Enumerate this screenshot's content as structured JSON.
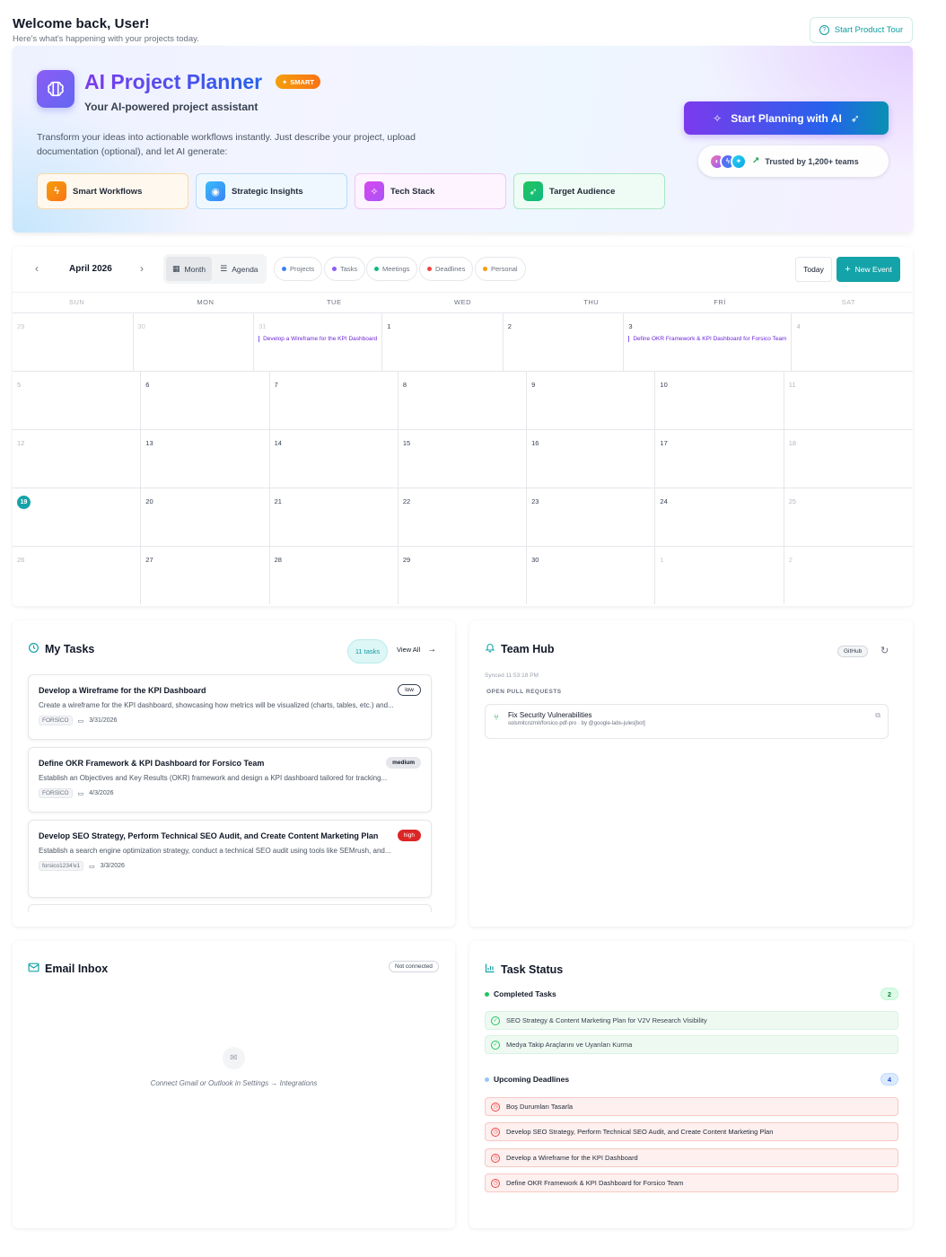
{
  "header": {
    "title": "Welcome back, User!",
    "subtitle": "Here's what's happening with your projects today.",
    "tour_button": "Start Product Tour"
  },
  "hero": {
    "title": "AI Project Planner",
    "badge": "SMART",
    "subtitle": "Your AI-powered project assistant",
    "description": "Transform your ideas into actionable workflows instantly. Just describe your project, upload documentation (optional), and let AI generate:",
    "features": [
      "Smart Workflows",
      "Strategic Insights",
      "Tech Stack",
      "Target Audience"
    ],
    "cta": "Start Planning with AI",
    "trusted": "Trusted by 1,200+ teams"
  },
  "calendar": {
    "month": "April 2026",
    "views": [
      "Month",
      "Agenda"
    ],
    "filters": [
      {
        "label": "Projects",
        "color": "#3b82f6"
      },
      {
        "label": "Tasks",
        "color": "#8b5cf6"
      },
      {
        "label": "Meetings",
        "color": "#10b981"
      },
      {
        "label": "Deadlines",
        "color": "#ef4444"
      },
      {
        "label": "Personal",
        "color": "#f59e0b"
      }
    ],
    "today_button": "Today",
    "new_event_button": "New Event",
    "weekdays": [
      "SUN",
      "MON",
      "TUE",
      "WED",
      "THU",
      "FRİ",
      "SAT"
    ],
    "weeks": [
      [
        {
          "n": "29",
          "m": true
        },
        {
          "n": "30",
          "m": true
        },
        {
          "n": "31",
          "m": true,
          "ev": "Develop a Wireframe for the KPI Dashboard"
        },
        {
          "n": "1"
        },
        {
          "n": "2"
        },
        {
          "n": "3",
          "ev": "Define OKR Framework & KPI Dashboard for Forsico Team"
        },
        {
          "n": "4",
          "w": true
        }
      ],
      [
        {
          "n": "5",
          "w": true
        },
        {
          "n": "6"
        },
        {
          "n": "7"
        },
        {
          "n": "8"
        },
        {
          "n": "9"
        },
        {
          "n": "10"
        },
        {
          "n": "11",
          "w": true
        }
      ],
      [
        {
          "n": "12",
          "w": true
        },
        {
          "n": "13"
        },
        {
          "n": "14"
        },
        {
          "n": "15"
        },
        {
          "n": "16"
        },
        {
          "n": "17"
        },
        {
          "n": "18",
          "w": true
        }
      ],
      [
        {
          "n": "19",
          "today": true
        },
        {
          "n": "20"
        },
        {
          "n": "21"
        },
        {
          "n": "22"
        },
        {
          "n": "23"
        },
        {
          "n": "24"
        },
        {
          "n": "25",
          "w": true
        }
      ],
      [
        {
          "n": "26",
          "w": true
        },
        {
          "n": "27"
        },
        {
          "n": "28"
        },
        {
          "n": "29"
        },
        {
          "n": "30"
        },
        {
          "n": "1",
          "m": true
        },
        {
          "n": "2",
          "m": true
        }
      ]
    ]
  },
  "tasks": {
    "title": "My Tasks",
    "count": "11 tasks",
    "view_all": "View All",
    "items": [
      {
        "title": "Develop a Wireframe for the KPI Dashboard",
        "priority": "low",
        "description": "Create a wireframe for the KPI dashboard, showcasing how metrics will be visualized (charts, tables, etc.) and...",
        "tag": "FORSİCO",
        "date": "3/31/2026"
      },
      {
        "title": "Define OKR Framework & KPI Dashboard for Forsico Team",
        "priority": "medium",
        "description": "Establish an Objectives and Key Results (OKR) framework and design a KPI dashboard tailored for tracking...",
        "tag": "FORSİCO",
        "date": "4/3/2026"
      },
      {
        "title": "Develop SEO Strategy, Perform Technical SEO Audit, and Create Content Marketing Plan",
        "priority": "high",
        "description": "Establish a search engine optimization strategy, conduct a technical SEO audit using tools like SEMrush, and...",
        "tag": "forsico1234'e1",
        "date": "3/3/2026"
      }
    ]
  },
  "team_hub": {
    "title": "Team Hub",
    "badge": "GitHub",
    "synced": "Synced 11:53:18 PM",
    "section": "OPEN PULL REQUESTS",
    "pr_title": "Fix Security Vulnerabilities",
    "pr_sub": "solsmitcnzmit/forsico-pdf-pro · by @google-labs-jules[bot]"
  },
  "email": {
    "title": "Email Inbox",
    "badge": "Not connected",
    "empty_text": "Connect Gmail or Outlook in Settings → Integrations"
  },
  "task_status": {
    "title": "Task Status",
    "completed_label": "Completed Tasks",
    "completed_count": "2",
    "completed": [
      "SEO Strategy & Content Marketing Plan for V2V Research Visibility",
      "Medya Takip Araçlarını ve Uyarıları Kurma"
    ],
    "upcoming_label": "Upcoming Deadlines",
    "upcoming_count": "4",
    "upcoming": [
      "Boş Durumları Tasarla",
      "Develop SEO Strategy, Perform Technical SEO Audit, and Create Content Marketing Plan",
      "Develop a Wireframe for the KPI Dashboard",
      "Define OKR Framework & KPI Dashboard for Forsico Team"
    ]
  }
}
